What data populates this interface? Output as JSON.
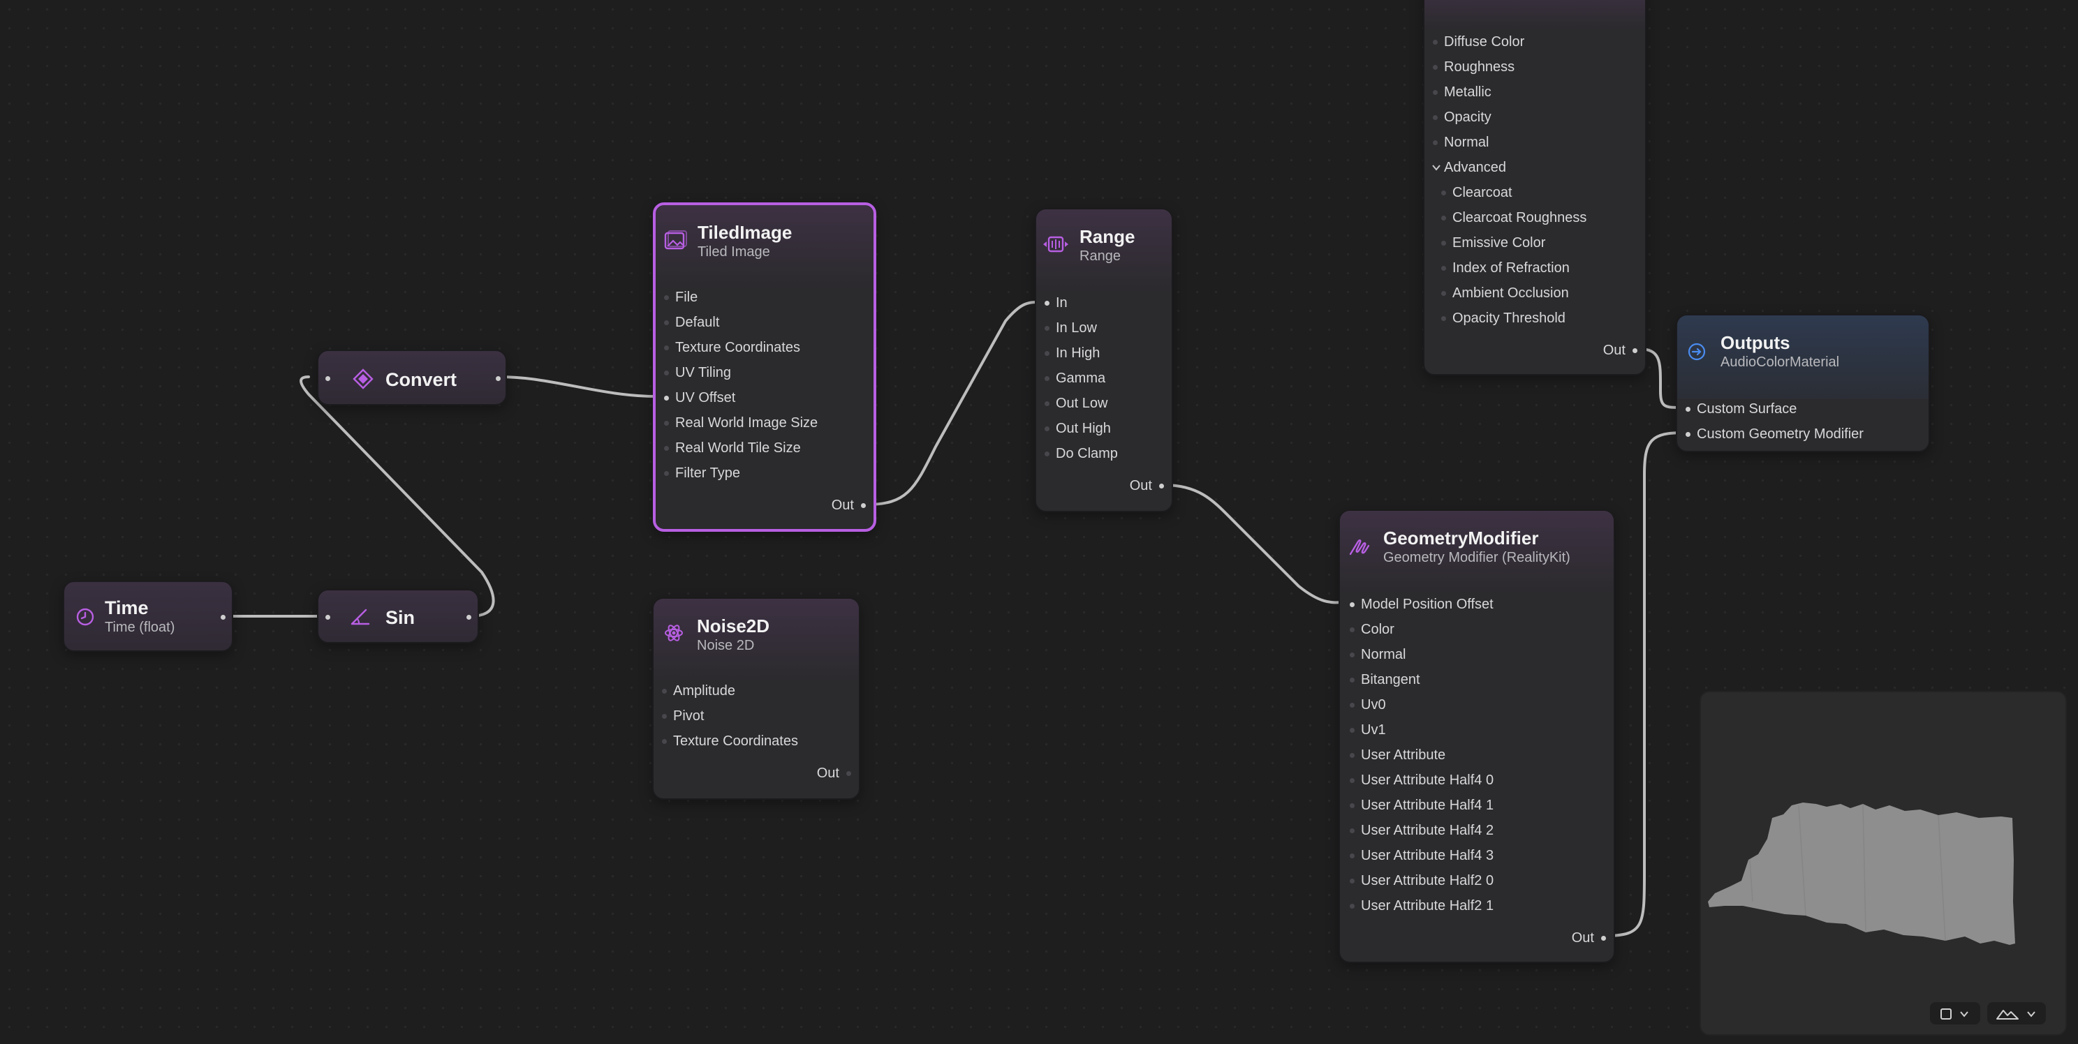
{
  "canvas": {
    "background": "#1e1e1f",
    "accent": "#b85fe3",
    "wire_color": "#bdbdbd"
  },
  "nodes": {
    "time": {
      "title": "Time",
      "subtitle": "Time (float)",
      "icon": "clock-icon"
    },
    "sin": {
      "title": "Sin",
      "icon": "angle-icon"
    },
    "convert": {
      "title": "Convert",
      "icon": "diamond-icon"
    },
    "tiledimage": {
      "title": "TiledImage",
      "subtitle": "Tiled Image",
      "icon": "image-icon",
      "inputs": [
        "File",
        "Default",
        "Texture Coordinates",
        "UV Tiling",
        "UV Offset",
        "Real World Image Size",
        "Real World Tile Size",
        "Filter Type"
      ],
      "output": "Out"
    },
    "noise2d": {
      "title": "Noise2D",
      "subtitle": "Noise 2D",
      "icon": "atom-icon",
      "inputs": [
        "Amplitude",
        "Pivot",
        "Texture Coordinates"
      ],
      "output": "Out"
    },
    "range": {
      "title": "Range",
      "subtitle": "Range",
      "icon": "range-icon",
      "inputs": [
        "In",
        "In Low",
        "In High",
        "Gamma",
        "Out Low",
        "Out High",
        "Do Clamp"
      ],
      "output": "Out"
    },
    "preview_surface": {
      "inputs": [
        "Diffuse Color",
        "Roughness",
        "Metallic",
        "Opacity",
        "Normal"
      ],
      "advanced_label": "Advanced",
      "advanced_inputs": [
        "Clearcoat",
        "Clearcoat Roughness",
        "Emissive Color",
        "Index of Refraction",
        "Ambient Occlusion",
        "Opacity Threshold"
      ],
      "output": "Out"
    },
    "geometry_modifier": {
      "title": "GeometryModifier",
      "subtitle": "Geometry Modifier (RealityKit)",
      "icon": "scribble-icon",
      "inputs": [
        "Model Position Offset",
        "Color",
        "Normal",
        "Bitangent",
        "Uv0",
        "Uv1",
        "User Attribute",
        "User Attribute Half4 0",
        "User Attribute Half4 1",
        "User Attribute Half4 2",
        "User Attribute Half4 3",
        "User Attribute Half2 0",
        "User Attribute Half2 1"
      ],
      "output": "Out"
    },
    "outputs": {
      "title": "Outputs",
      "subtitle": "AudioColorMaterial",
      "icon": "arrow-circle-icon",
      "inputs": [
        "Custom Surface",
        "Custom Geometry Modifier"
      ]
    }
  },
  "preview": {
    "shape_color": "#8e8e8e",
    "controls": [
      "square-icon",
      "chevron-down-icon",
      "terrain-icon",
      "chevron-down-icon"
    ]
  }
}
